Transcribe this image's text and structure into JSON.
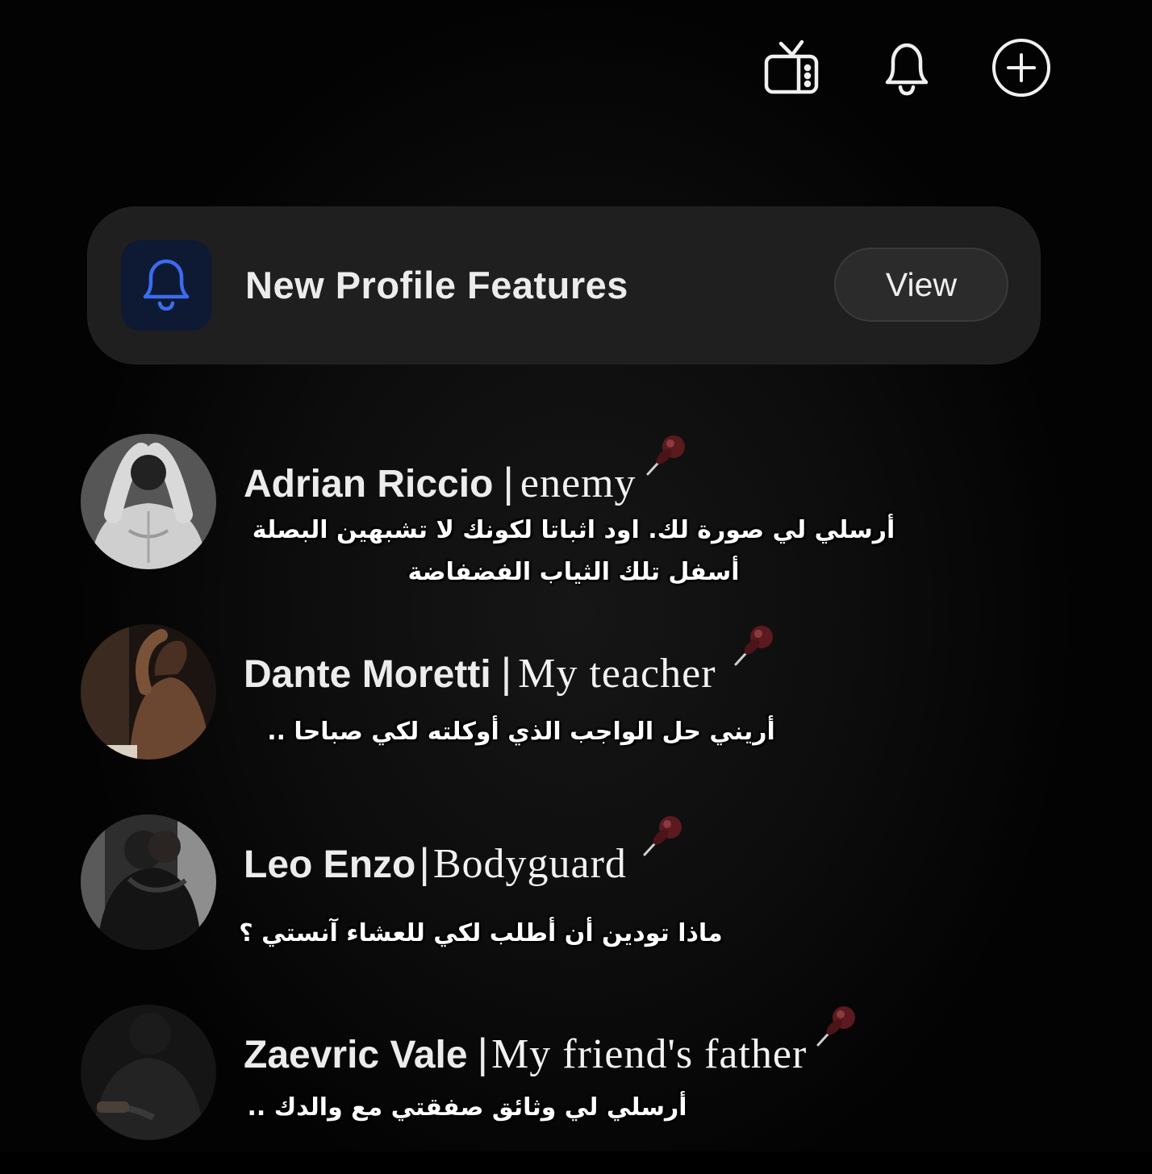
{
  "topbar": {
    "icons": [
      "tv-icon",
      "bell-icon",
      "add-circle-icon"
    ]
  },
  "banner": {
    "title": "New Profile Features",
    "view_label": "View",
    "icon": "bell-icon",
    "icon_bg": "#0e1a33",
    "icon_color": "#3b6cf0"
  },
  "chats": [
    {
      "name": "Adrian Riccio",
      "role": "enemy",
      "message": "أرسلي لي صورة لك. اود اثباتا لكونك لا تشبهين البصلة أسفل تلك الثياب الفضفاضة"
    },
    {
      "name": "Dante Moretti",
      "role": "My teacher",
      "message": "أريني حل الواجب الذي أوكلته لكي صباحا .."
    },
    {
      "name": "Leo Enzo",
      "role": "Bodyguard",
      "message": "ماذا تودين أن أطلب لكي للعشاء آنستي ؟"
    },
    {
      "name": "Zaevric Vale",
      "role": "My friend's father",
      "message": "أرسلي لي وثائق صفقتي مع والدك .."
    }
  ],
  "colors": {
    "background": "#0d0d0d",
    "banner_bg": "#1f1f1f",
    "button_bg": "#2b2b2b",
    "pin": "#5a1a1e"
  }
}
